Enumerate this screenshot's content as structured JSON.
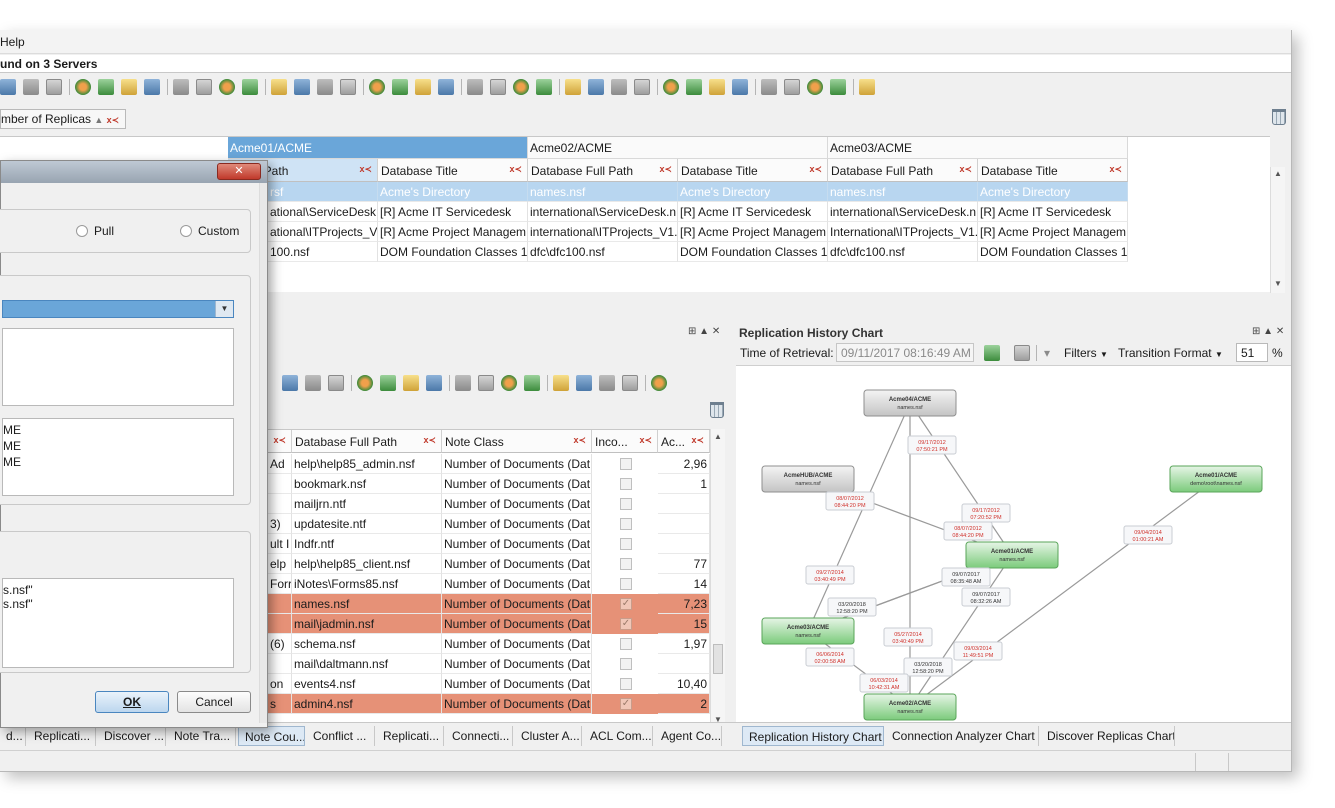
{
  "menu": {
    "help": "Help"
  },
  "window_title": "und on 3 Servers",
  "filter_chip": {
    "label": "mber of Replicas"
  },
  "top_grid": {
    "servers": [
      "Acme01/ACME",
      "Acme02/ACME",
      "Acme03/ACME"
    ],
    "columns": [
      "e Full Path",
      "Database Title",
      "Database Full Path",
      "Database Title",
      "Database Full Path",
      "Database Title"
    ],
    "selected_row": [
      "rsf",
      "Acme's Directory",
      "names.nsf",
      "Acme's Directory",
      "names.nsf",
      "Acme's Directory"
    ],
    "rows": [
      [
        "ational\\ServiceDesk.n",
        "[R] Acme IT Servicedesk",
        "international\\ServiceDesk.n",
        "[R] Acme IT Servicedesk",
        "international\\ServiceDesk.n",
        "[R] Acme IT Servicedesk"
      ],
      [
        "ational\\ITProjects_V1.",
        "[R] Acme Project Managem",
        "international\\ITProjects_V1.",
        "[R] Acme Project Managem",
        "International\\ITProjects_V1.",
        "[R] Acme Project Managem"
      ],
      [
        "100.nsf",
        "DOM Foundation Classes 1.",
        "dfc\\dfc100.nsf",
        "DOM Foundation Classes 1.",
        "dfc\\dfc100.nsf",
        "DOM Foundation Classes 1."
      ]
    ]
  },
  "lower_grid": {
    "columns": [
      "Database Full Path",
      "Note Class",
      "Inco...",
      "Ac..."
    ],
    "rows": [
      {
        "frag": "Ad",
        "path": "help\\help85_admin.nsf",
        "cls": "Number of Documents (Dat",
        "num": "2,96",
        "red": false,
        "checked": false
      },
      {
        "frag": "",
        "path": "bookmark.nsf",
        "cls": "Number of Documents (Dat",
        "num": "1",
        "red": false,
        "checked": false
      },
      {
        "frag": "",
        "path": "mailjrn.ntf",
        "cls": "Number of Documents (Dat",
        "num": "",
        "red": false,
        "checked": false
      },
      {
        "frag": "3)",
        "path": "updatesite.ntf",
        "cls": "Number of Documents (Dat",
        "num": "",
        "red": false,
        "checked": false
      },
      {
        "frag": "ult I",
        "path": "Indfr.ntf",
        "cls": "Number of Documents (Dat",
        "num": "",
        "red": false,
        "checked": false
      },
      {
        "frag": "elp",
        "path": "help\\help85_client.nsf",
        "cls": "Number of Documents (Dat",
        "num": "77",
        "red": false,
        "checked": false
      },
      {
        "frag": "Forr",
        "path": "iNotes\\Forms85.nsf",
        "cls": "Number of Documents (Dat",
        "num": "14",
        "red": false,
        "checked": false
      },
      {
        "frag": "",
        "path": "names.nsf",
        "cls": "Number of Documents (Dat",
        "num": "7,23",
        "red": true,
        "checked": true
      },
      {
        "frag": "",
        "path": "mail\\jadmin.nsf",
        "cls": "Number of Documents (Dat",
        "num": "15",
        "red": true,
        "checked": true
      },
      {
        "frag": "(6)",
        "path": "schema.nsf",
        "cls": "Number of Documents (Dat",
        "num": "1,97",
        "red": false,
        "checked": false
      },
      {
        "frag": "",
        "path": "mail\\daltmann.nsf",
        "cls": "Number of Documents (Dat",
        "num": "",
        "red": false,
        "checked": false
      },
      {
        "frag": "on",
        "path": "events4.nsf",
        "cls": "Number of Documents (Dat",
        "num": "10,40",
        "red": false,
        "checked": false
      },
      {
        "frag": "s",
        "path": "admin4.nsf",
        "cls": "Number of Documents (Dat",
        "num": "2",
        "red": true,
        "checked": true
      }
    ]
  },
  "chart_panel": {
    "title": "Replication History Chart",
    "time_label": "Time of Retrieval:",
    "time_value": "09/11/2017 08:16:49 AM",
    "filters_label": "Filters",
    "transition_label": "Transition Format",
    "zoom_value": "51",
    "zoom_unit": "%",
    "nodes": [
      {
        "server": "Acme04/ACME",
        "db": "names.nsf",
        "kind": "gray"
      },
      {
        "server": "AcmeHUB/ACME",
        "db": "names.nsf",
        "kind": "gray"
      },
      {
        "server": "Acme01/ACME",
        "db": "demo\\root\\names.nsf",
        "kind": "green"
      },
      {
        "server": "Acme01/ACME",
        "db": "names.nsf",
        "kind": "green"
      },
      {
        "server": "Acme03/ACME",
        "db": "names.nsf",
        "kind": "green"
      },
      {
        "server": "Acme02/ACME",
        "db": "names.nsf",
        "kind": "green"
      }
    ],
    "edge_labels": [
      {
        "d": "09/17/2012",
        "t": "07:50:21 PM",
        "red": true
      },
      {
        "d": "08/07/2012",
        "t": "08:44:20 PM",
        "red": true
      },
      {
        "d": "09/17/2012",
        "t": "07:20:52 PM",
        "red": true
      },
      {
        "d": "08/07/2012",
        "t": "08:44:20 PM",
        "red": true
      },
      {
        "d": "09/04/2014",
        "t": "01:00:21 AM",
        "red": true
      },
      {
        "d": "09/27/2014",
        "t": "03:40:49 PM",
        "red": true
      },
      {
        "d": "09/07/2017",
        "t": "08:35:48 AM",
        "red": false
      },
      {
        "d": "09/07/2017",
        "t": "08:32:26 AM",
        "red": false
      },
      {
        "d": "03/20/2018",
        "t": "12:58:20 PM",
        "red": false
      },
      {
        "d": "05/27/2014",
        "t": "03:40:49 PM",
        "red": true
      },
      {
        "d": "09/03/2014",
        "t": "11:49:51 PM",
        "red": true
      },
      {
        "d": "06/06/2014",
        "t": "02:00:58 AM",
        "red": true
      },
      {
        "d": "03/20/2018",
        "t": "12:58:20 PM",
        "red": false
      },
      {
        "d": "06/03/2014",
        "t": "10:42:31 AM",
        "red": true
      }
    ]
  },
  "dialog": {
    "close": "✕",
    "radio_pull": "Pull",
    "radio_custom": "Custom",
    "list_items": [
      "ME",
      "ME",
      "ME"
    ],
    "bottom_items": [
      "s.nsf\"",
      "s.nsf\""
    ],
    "ok": "OK",
    "cancel": "Cancel"
  },
  "tabs": [
    "d...",
    "Replicati...",
    "Discover ...",
    "Note Tra...",
    "Note Cou...",
    "Conflict ...",
    "Replicati...",
    "Connecti...",
    "Cluster A...",
    "ACL Com...",
    "Agent Co...",
    "Replication History Chart",
    "Connection Analyzer Chart",
    "Discover Replicas Chart"
  ]
}
